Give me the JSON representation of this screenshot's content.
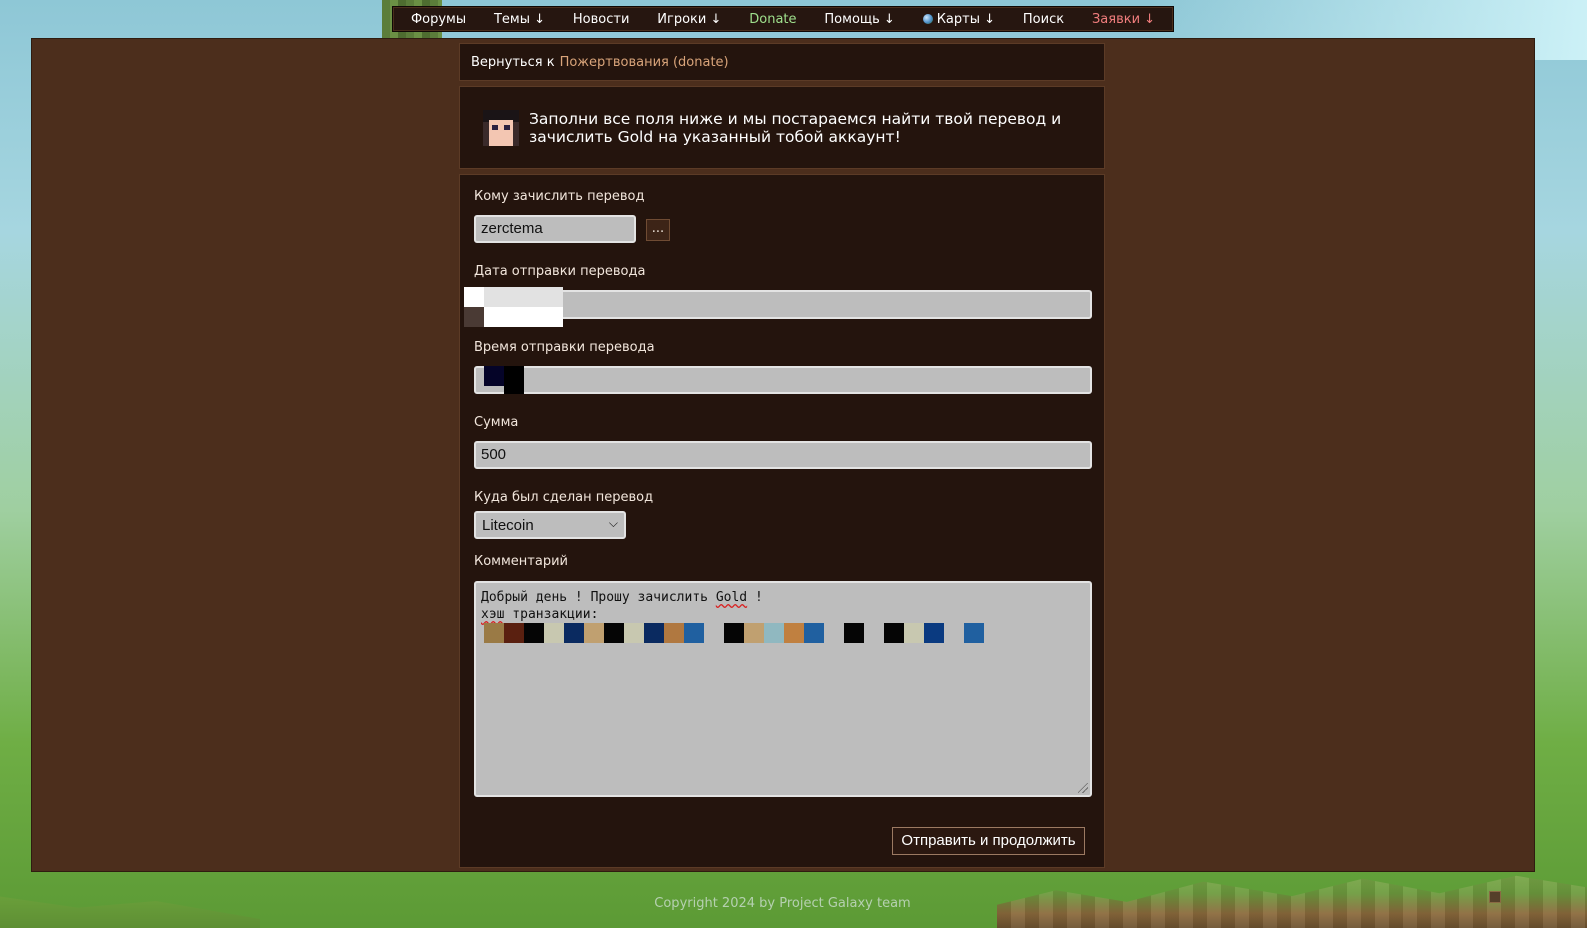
{
  "nav": {
    "items": [
      {
        "label": "Форумы"
      },
      {
        "label": "Темы ↓"
      },
      {
        "label": "Новости"
      },
      {
        "label": "Игроки ↓"
      },
      {
        "label": "Donate"
      },
      {
        "label": "Помощь ↓"
      },
      {
        "label": "Карты ↓"
      },
      {
        "label": "Поиск"
      },
      {
        "label": "Заявки ↓"
      }
    ],
    "donate_color": "#9fe08d",
    "requests_color": "#f07d7d"
  },
  "back": {
    "prefix": "Вернуться к",
    "link": "Пожертвования (donate)"
  },
  "intro": {
    "text": "Заполни все поля ниже и мы постараемся найти твой перевод и зачислить Gold на указанный тобой аккаунт!"
  },
  "form": {
    "recipient_label": "Кому зачислить перевод",
    "recipient_value": "zerctema",
    "picker_label": "...",
    "date_label": "Дата отправки перевода",
    "date_value": "",
    "time_label": "Время отправки перевода",
    "time_value": "",
    "amount_label": "Сумма",
    "amount_value": "500",
    "destination_label": "Куда был сделан перевод",
    "destination_value": "Litecoin",
    "comment_label": "Комментарий",
    "comment_line1": "Добрый день ! Прошу зачислить ",
    "comment_gold": "Gold",
    "comment_line1_end": " !",
    "comment_line2a": "хэш",
    "comment_line2b": " транзакции:",
    "submit_label": "Отправить и продолжить"
  },
  "footer": {
    "copyright": "Copyright 2024 by Project Galaxy team"
  }
}
